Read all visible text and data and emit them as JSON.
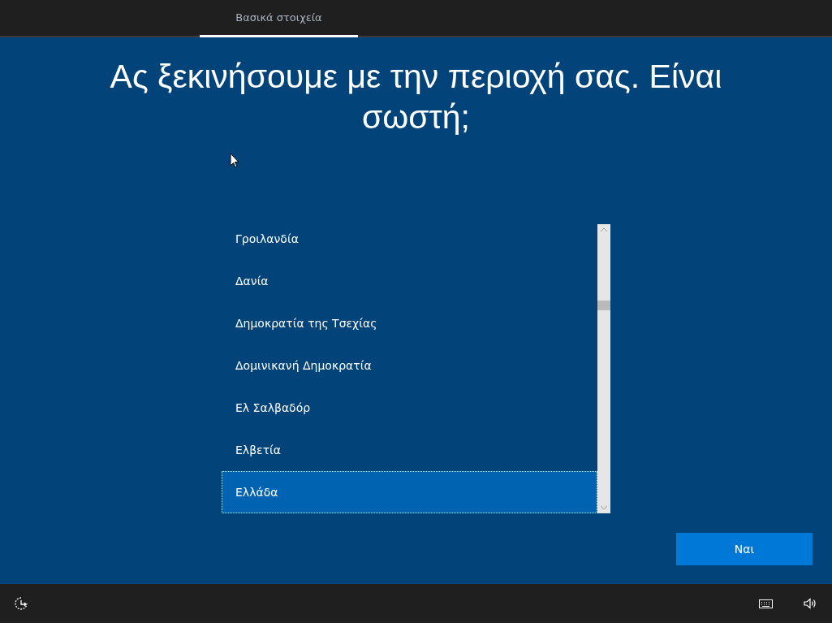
{
  "tabs": [
    {
      "label": "Βασικά στοιχεία",
      "selected": true
    }
  ],
  "heading": "Ας ξεκινήσουμε με την περιοχή σας. Είναι σωστή;",
  "regions": [
    {
      "label": "Γροιλανδία",
      "selected": false
    },
    {
      "label": "Δανία",
      "selected": false
    },
    {
      "label": "Δημοκρατία της Τσεχίας",
      "selected": false
    },
    {
      "label": "Δομινικανή Δημοκρατία",
      "selected": false
    },
    {
      "label": "Ελ Σαλβαδόρ",
      "selected": false
    },
    {
      "label": "Ελβετία",
      "selected": false
    },
    {
      "label": "Ελλάδα",
      "selected": true
    }
  ],
  "primary_button": "Ναι"
}
